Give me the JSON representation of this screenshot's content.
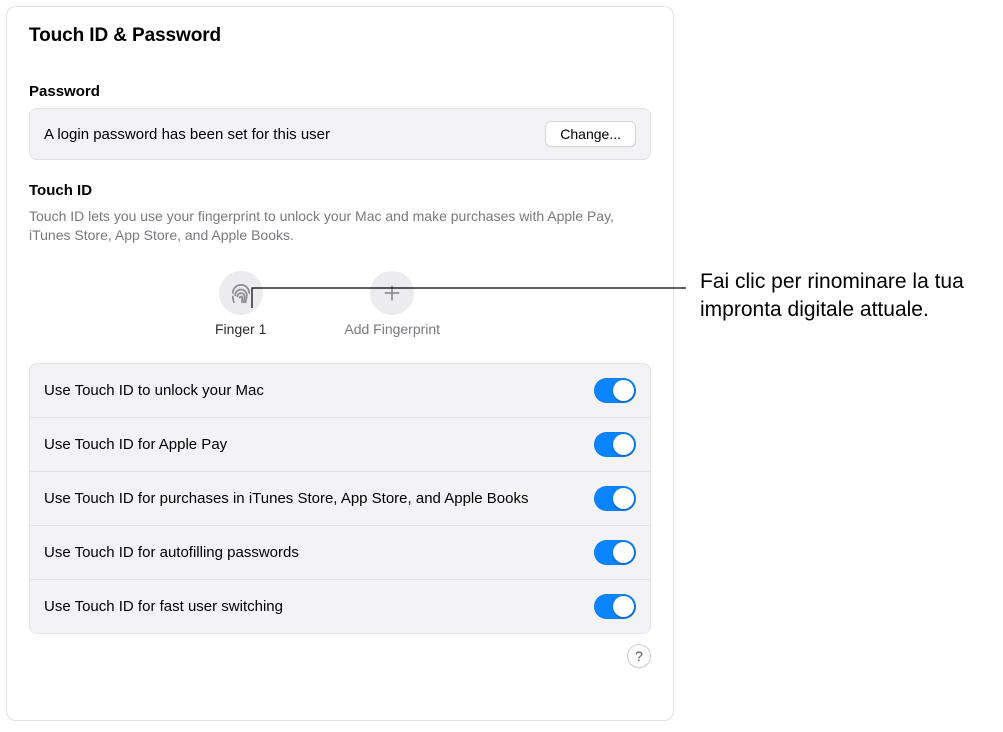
{
  "header": {
    "title": "Touch ID & Password"
  },
  "password": {
    "heading": "Password",
    "status": "A login password has been set for this user",
    "change_label": "Change..."
  },
  "touchid": {
    "heading": "Touch ID",
    "description": "Touch ID lets you use your fingerprint to unlock your Mac and make purchases with Apple Pay, iTunes Store, App Store, and Apple Books.",
    "finger_label": "Finger 1",
    "add_label": "Add Fingerprint"
  },
  "options": [
    {
      "label": "Use Touch ID to unlock your Mac",
      "on": true
    },
    {
      "label": "Use Touch ID for Apple Pay",
      "on": true
    },
    {
      "label": "Use Touch ID for purchases in iTunes Store, App Store, and Apple Books",
      "on": true
    },
    {
      "label": "Use Touch ID for autofilling passwords",
      "on": true
    },
    {
      "label": "Use Touch ID for fast user switching",
      "on": true
    }
  ],
  "help_label": "?",
  "callout": "Fai clic per rinominare la tua impronta digitale attuale."
}
